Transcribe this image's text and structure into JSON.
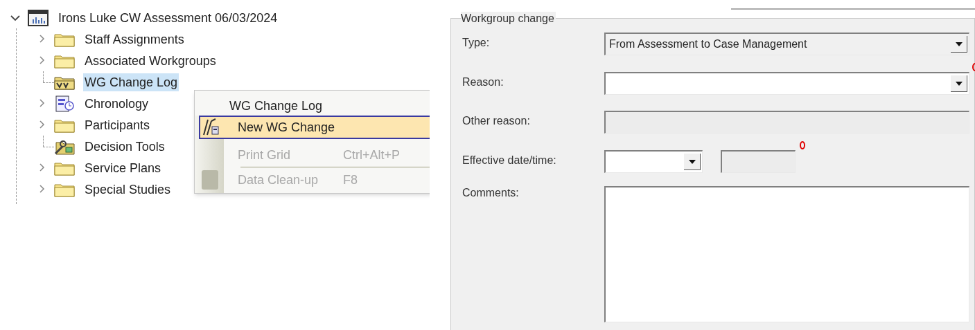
{
  "tree": {
    "label": "Irons Luke CW Assessment 06/03/2024",
    "expanded": true,
    "children": [
      {
        "label": "Staff Assignments",
        "kind": "folder",
        "expandable": true,
        "selected": false
      },
      {
        "label": "Associated Workgroups",
        "kind": "folder",
        "expandable": true,
        "selected": false
      },
      {
        "label": "WG Change Log",
        "kind": "log",
        "expandable": false,
        "selected": true
      },
      {
        "label": "Chronology",
        "kind": "chronology",
        "expandable": true,
        "selected": false
      },
      {
        "label": "Participants",
        "kind": "folder",
        "expandable": true,
        "selected": false
      },
      {
        "label": "Decision Tools",
        "kind": "tools",
        "expandable": false,
        "selected": false
      },
      {
        "label": "Service Plans",
        "kind": "folder",
        "expandable": true,
        "selected": false
      },
      {
        "label": "Special Studies",
        "kind": "folder",
        "expandable": true,
        "selected": false
      }
    ]
  },
  "context_menu": {
    "title": "WG Change Log",
    "items": [
      {
        "label": "New WG Change",
        "selected": true,
        "disabled": false
      },
      {
        "label": "Print Grid",
        "shortcut": "Ctrl+Alt+P",
        "selected": false,
        "disabled": true
      },
      {
        "label": "Data Clean-up",
        "shortcut": "F8",
        "selected": false,
        "disabled": true
      }
    ]
  },
  "form": {
    "legend": "Workgroup change",
    "fields": [
      {
        "label": "Type:",
        "kind": "combo",
        "value": "From Assessment to Case Management",
        "disabled": true,
        "required": false
      },
      {
        "label": "Reason:",
        "kind": "combo",
        "disabled": false,
        "required": true
      },
      {
        "label": "Other reason:",
        "kind": "text",
        "disabled": true,
        "required": false
      },
      {
        "label": "Effective date/time:",
        "kind": "datetime",
        "disabled": false,
        "required": true
      },
      {
        "label": "Comments:",
        "kind": "textarea",
        "disabled": false,
        "required": false
      }
    ]
  }
}
